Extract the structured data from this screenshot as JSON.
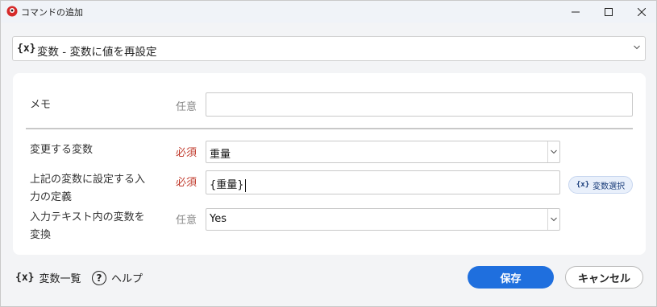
{
  "window": {
    "title": "コマンドの追加"
  },
  "command": {
    "icon_text": "{x}",
    "label": "変数 - 変数に値を再設定"
  },
  "form": {
    "memo": {
      "label": "メモ",
      "badge": "任意",
      "value": ""
    },
    "variable": {
      "label": "変更する変数",
      "badge": "必須",
      "value": "重量"
    },
    "definition": {
      "label_line1": "上記の変数に設定する入",
      "label_line2": "力の定義",
      "badge": "必須",
      "value": "{重量}"
    },
    "expand": {
      "label_line1": "入力テキスト内の変数を",
      "label_line2": "変換",
      "badge": "任意",
      "value": "Yes"
    },
    "var_select_button": {
      "icon_text": "{x}",
      "label": "変数選択"
    }
  },
  "footer": {
    "variables_list": {
      "icon_text": "{x}",
      "label": "変数一覧"
    },
    "help": {
      "icon_text": "?",
      "label": "ヘルプ"
    },
    "save_label": "保存",
    "cancel_label": "キャンセル"
  },
  "colors": {
    "required": "#c0392b",
    "optional": "#888888",
    "primary": "#1f6fde",
    "panel_bg": "#ffffff",
    "window_bg": "#f3f4f6"
  }
}
